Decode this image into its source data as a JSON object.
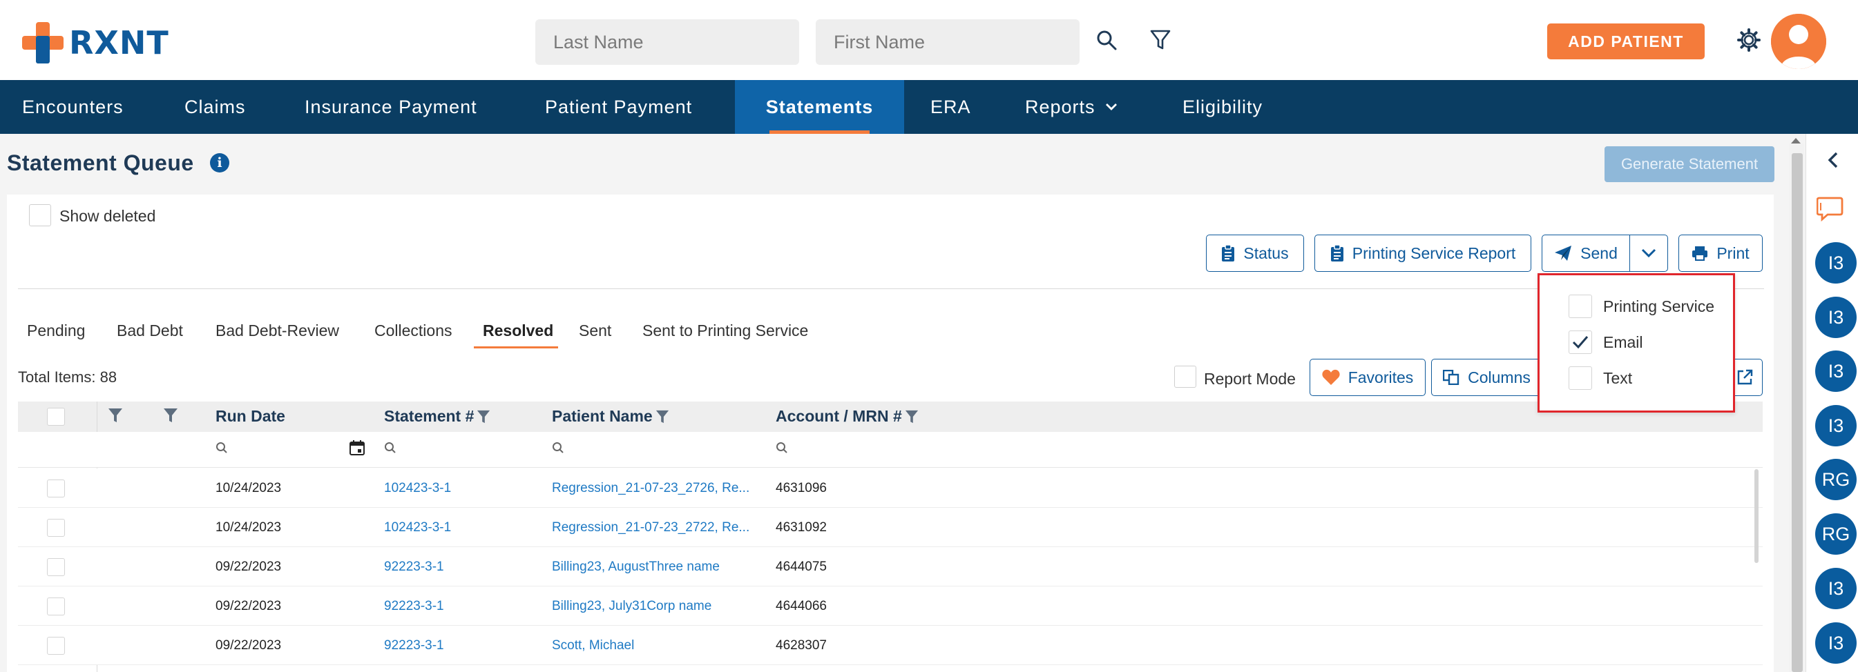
{
  "brand": {
    "name": "RXNT",
    "orange": "#f47b3b",
    "blue": "#0f5a9b",
    "navy": "#0a3d62"
  },
  "header": {
    "last_name_placeholder": "Last Name",
    "first_name_placeholder": "First Name",
    "add_patient": "ADD PATIENT",
    "icons": [
      "search-icon",
      "filter-icon",
      "gear-icon",
      "user-avatar-icon"
    ]
  },
  "nav": {
    "items": [
      {
        "label": "Encounters"
      },
      {
        "label": "Claims"
      },
      {
        "label": "Insurance Payment"
      },
      {
        "label": "Patient Payment"
      },
      {
        "label": "Statements",
        "active": true
      },
      {
        "label": "ERA"
      },
      {
        "label": "Reports",
        "has_dropdown": true
      },
      {
        "label": "Eligibility"
      }
    ]
  },
  "page": {
    "title": "Statement Queue",
    "generate_statement": "Generate Statement",
    "show_deleted": "Show deleted"
  },
  "toolbar": {
    "status": "Status",
    "printing_service_report": "Printing Service Report",
    "send": "Send",
    "print": "Print",
    "report_mode": "Report Mode",
    "favorites": "Favorites",
    "columns": "Columns"
  },
  "tabs": [
    {
      "label": "Pending"
    },
    {
      "label": "Bad Debt"
    },
    {
      "label": "Bad Debt-Review"
    },
    {
      "label": "Collections"
    },
    {
      "label": "Resolved",
      "active": true
    },
    {
      "label": "Sent"
    },
    {
      "label": "Sent to Printing Service"
    }
  ],
  "total_items": "Total Items: 88",
  "send_dropdown": {
    "options": [
      {
        "label": "Printing Service",
        "checked": false
      },
      {
        "label": "Email",
        "checked": true
      },
      {
        "label": "Text",
        "checked": false
      }
    ]
  },
  "table": {
    "columns": [
      "Run Date",
      "Statement #",
      "Patient Name",
      "Account / MRN #"
    ],
    "rows": [
      {
        "run_date": "10/24/2023",
        "statement": "102423-3-1",
        "patient": "Regression_21-07-23_2726, Re...",
        "account": "4631096"
      },
      {
        "run_date": "10/24/2023",
        "statement": "102423-3-1",
        "patient": "Regression_21-07-23_2722, Re...",
        "account": "4631092"
      },
      {
        "run_date": "09/22/2023",
        "statement": "92223-3-1",
        "patient": "Billing23, AugustThree name",
        "account": "4644075"
      },
      {
        "run_date": "09/22/2023",
        "statement": "92223-3-1",
        "patient": "Billing23, July31Corp name",
        "account": "4644066"
      },
      {
        "run_date": "09/22/2023",
        "statement": "92223-3-1",
        "patient": "Scott, Michael",
        "account": "4628307"
      }
    ]
  },
  "right_rail": {
    "avatars": [
      "I3",
      "I3",
      "I3",
      "I3",
      "RG",
      "RG",
      "I3",
      "I3"
    ]
  }
}
